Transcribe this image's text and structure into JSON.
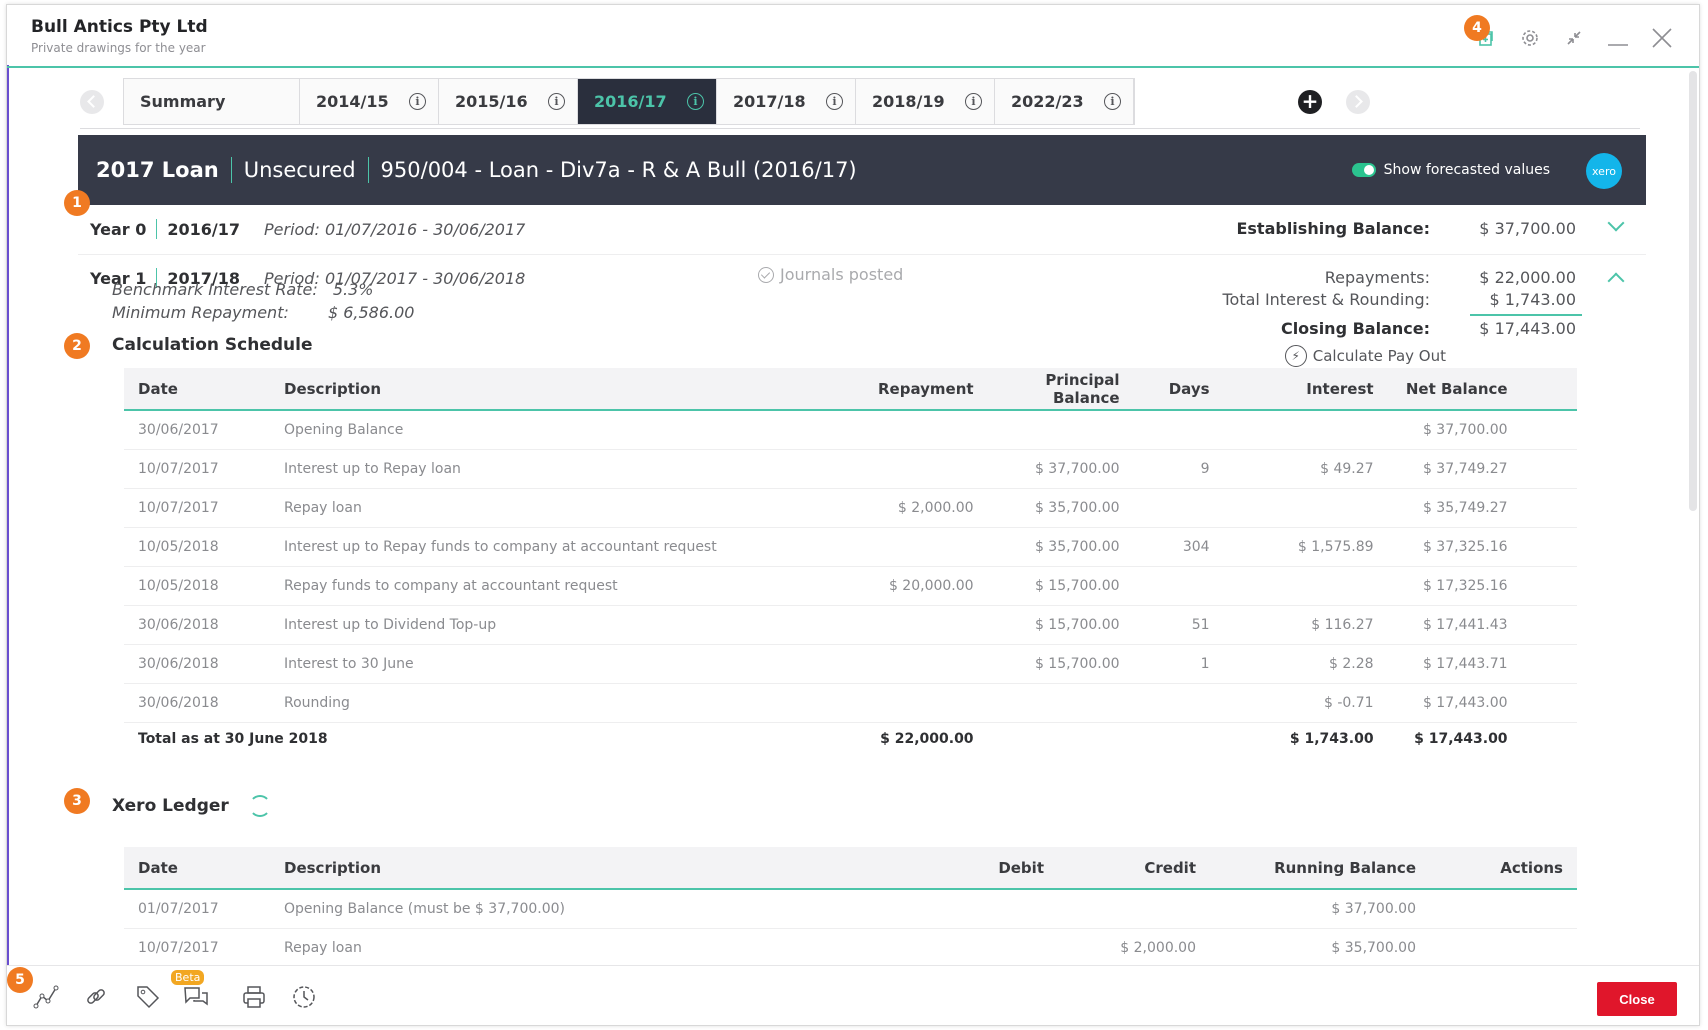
{
  "window": {
    "title": "Bull Antics Pty Ltd",
    "subtitle": "Private drawings for the year",
    "accent_color": "#4cc4a9",
    "icons": [
      "add-window-icon",
      "gear-icon",
      "collapse-icon",
      "minimize-icon",
      "close-icon"
    ]
  },
  "badges": [
    "1",
    "2",
    "3",
    "4",
    "5"
  ],
  "tabs": [
    {
      "label": "Summary",
      "info": false,
      "active": false
    },
    {
      "label": "2014/15",
      "info": true,
      "active": false
    },
    {
      "label": "2015/16",
      "info": true,
      "active": false
    },
    {
      "label": "2016/17",
      "info": true,
      "active": true
    },
    {
      "label": "2017/18",
      "info": true,
      "active": false
    },
    {
      "label": "2018/19",
      "info": true,
      "active": false
    },
    {
      "label": "2022/23",
      "info": true,
      "active": false
    }
  ],
  "tab_info_glyph": "i",
  "add_tab_glyph": "+",
  "loan": {
    "name": "2017 Loan",
    "security": "Unsecured",
    "account": "950/004 - Loan - Div7a - R & A Bull (2016/17)",
    "forecast_label": "Show forecasted values",
    "xero_label": "xero"
  },
  "year0": {
    "label": "Year 0",
    "fy": "2016/17",
    "period": "Period: 01/07/2016 - 30/06/2017",
    "establishing_label": "Establishing Balance:",
    "establishing_value": "$ 37,700.00"
  },
  "year1": {
    "label": "Year 1",
    "fy": "2017/18",
    "period": "Period: 01/07/2017 - 30/06/2018",
    "journals": "Journals posted",
    "benchmark_label": "Benchmark Interest Rate:",
    "benchmark_value": "5.3%",
    "min_repay_label": "Minimum Repayment:",
    "min_repay_value": "$ 6,586.00",
    "repayments_label": "Repayments:",
    "repayments_value": "$ 22,000.00",
    "interest_label": "Total Interest & Rounding:",
    "interest_value": "$ 1,743.00",
    "closing_label": "Closing Balance:",
    "closing_value": "$ 17,443.00"
  },
  "calc": {
    "title": "Calculation Schedule",
    "payout_label": "Calculate Pay Out",
    "columns": [
      "Date",
      "Description",
      "Repayment",
      "Principal Balance",
      "Days",
      "Interest",
      "Net Balance"
    ],
    "rows": [
      [
        "30/06/2017",
        "Opening Balance",
        "",
        "",
        "",
        "",
        "$ 37,700.00"
      ],
      [
        "10/07/2017",
        "Interest up to Repay loan",
        "",
        "$ 37,700.00",
        "9",
        "$ 49.27",
        "$ 37,749.27"
      ],
      [
        "10/07/2017",
        "Repay loan",
        "$ 2,000.00",
        "$ 35,700.00",
        "",
        "",
        "$ 35,749.27"
      ],
      [
        "10/05/2018",
        "Interest up to Repay funds to company at accountant request",
        "",
        "$ 35,700.00",
        "304",
        "$ 1,575.89",
        "$ 37,325.16"
      ],
      [
        "10/05/2018",
        "Repay funds to company at accountant request",
        "$ 20,000.00",
        "$ 15,700.00",
        "",
        "",
        "$ 17,325.16"
      ],
      [
        "30/06/2018",
        "Interest up to Dividend Top-up",
        "",
        "$ 15,700.00",
        "51",
        "$ 116.27",
        "$ 17,441.43"
      ],
      [
        "30/06/2018",
        "Interest to 30 June",
        "",
        "$ 15,700.00",
        "1",
        "$ 2.28",
        "$ 17,443.71"
      ],
      [
        "30/06/2018",
        "Rounding",
        "",
        "",
        "",
        "$ -0.71",
        "$ 17,443.00"
      ]
    ],
    "total": {
      "label": "Total as at 30 June 2018",
      "repayment": "$ 22,000.00",
      "interest": "$ 1,743.00",
      "net": "$ 17,443.00"
    }
  },
  "ledger": {
    "title": "Xero Ledger",
    "columns": [
      "Date",
      "Description",
      "Debit",
      "Credit",
      "Running Balance",
      "Actions"
    ],
    "rows": [
      [
        "01/07/2017",
        "Opening Balance (must be $ 37,700.00)",
        "",
        "",
        "$ 37,700.00",
        ""
      ],
      [
        "10/07/2017",
        "Repay loan",
        "",
        "$ 2,000.00",
        "$ 35,700.00",
        ""
      ]
    ]
  },
  "toolbar": {
    "icons": [
      "chart-line-icon",
      "link-icon",
      "tag-icon",
      "chat-icon",
      "print-icon",
      "history-icon"
    ],
    "beta_label": "Beta",
    "close_label": "Close",
    "close_color": "#e0162b"
  }
}
